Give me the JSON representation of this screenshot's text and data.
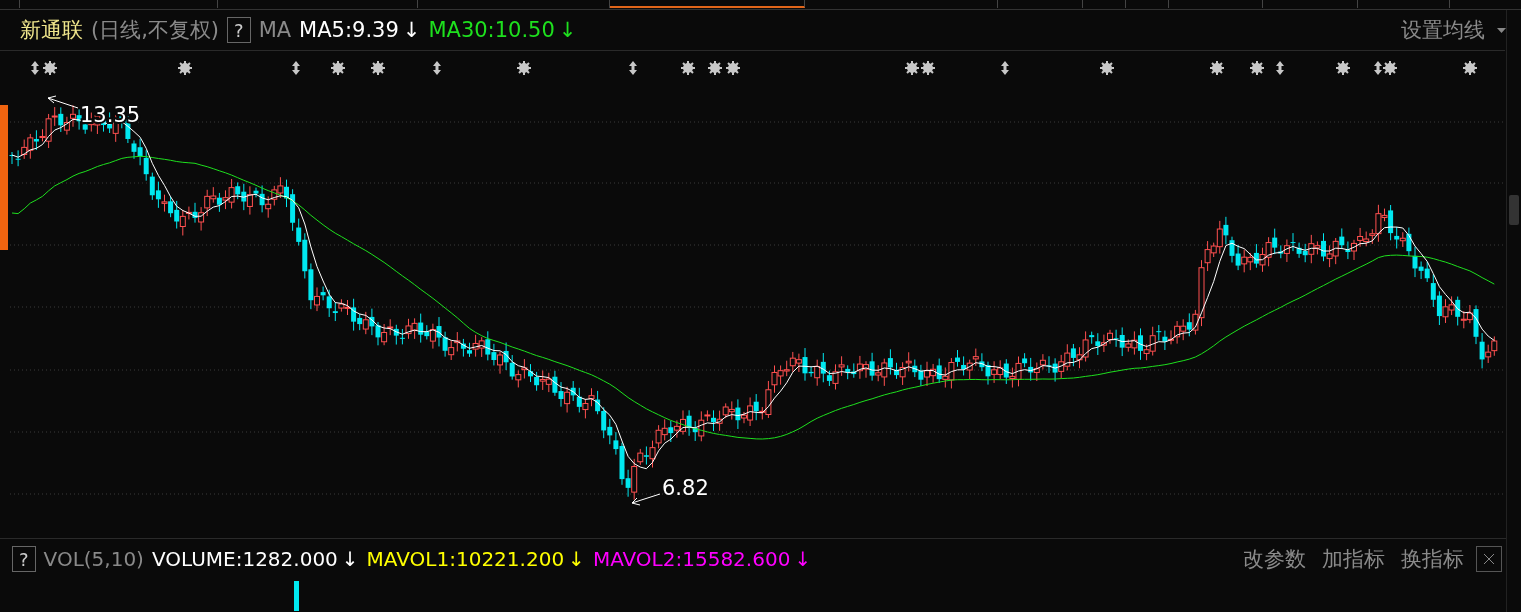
{
  "tabs": [
    {
      "selected": false
    },
    {
      "selected": false
    },
    {
      "selected": false
    },
    {
      "selected": false
    },
    {
      "selected": true
    },
    {
      "selected": false
    },
    {
      "selected": false
    },
    {
      "selected": false
    },
    {
      "selected": false
    },
    {
      "selected": false
    },
    {
      "selected": false
    },
    {
      "selected": false
    }
  ],
  "header": {
    "stock": "新通联",
    "period": "(日线,不复权)",
    "help": "?",
    "indicator": "MA",
    "settings": "设置均线"
  },
  "ma_lines": [
    {
      "text": "MA5:9.39",
      "arrow": "↓",
      "color": "#ffffff"
    },
    {
      "text": "MA30:10.50",
      "arrow": "↓",
      "color": "#1ee01e"
    }
  ],
  "chart": {
    "high_label": "13.35",
    "low_label": "6.82"
  },
  "volume_panel": {
    "help": "?",
    "indicator": "VOL(5,10)",
    "buttons": [
      "改参数",
      "加指标",
      "换指标"
    ]
  },
  "volume_lines": [
    {
      "text": "VOLUME:1282.000",
      "arrow": "↓",
      "color": "#ffffff"
    },
    {
      "text": "MAVOL1:10221.200",
      "arrow": "↓",
      "color": "#ffff00"
    },
    {
      "text": "MAVOL2:15582.600",
      "arrow": "↓",
      "color": "#ff00ff"
    }
  ]
}
